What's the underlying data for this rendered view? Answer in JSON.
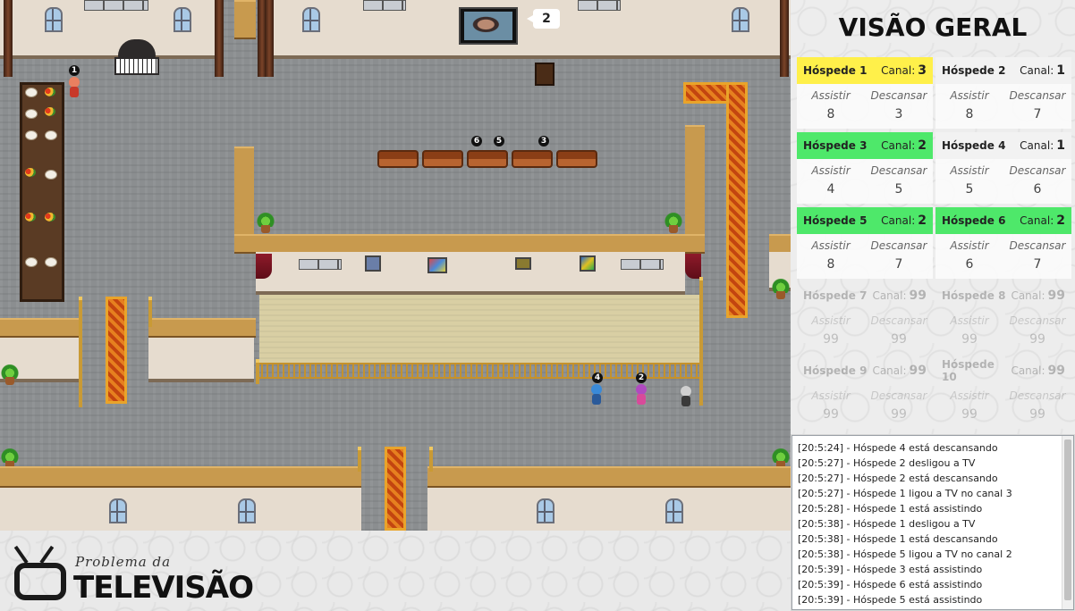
{
  "tv": {
    "channel_bubble": "2"
  },
  "map": {
    "table_guest": "1",
    "sofa_guests": [
      "6",
      "5",
      "3"
    ],
    "bottom_guests": [
      "4",
      "2"
    ]
  },
  "banner": {
    "subtitle": "Problema da",
    "title": "TELEVISÃO"
  },
  "panel": {
    "title": "VISÃO GERAL",
    "canal_label": "Canal:",
    "watch_label": "Assistir",
    "rest_label": "Descansar",
    "colors": {
      "watching": "#fff04a",
      "resting": "#4ee86a",
      "idle": "#f2f2f2"
    },
    "guests": [
      {
        "name": "Hóspede 1",
        "channel": "3",
        "watch": "8",
        "rest": "3",
        "state": "watching"
      },
      {
        "name": "Hóspede 2",
        "channel": "1",
        "watch": "8",
        "rest": "7",
        "state": "idle"
      },
      {
        "name": "Hóspede 3",
        "channel": "2",
        "watch": "4",
        "rest": "5",
        "state": "resting"
      },
      {
        "name": "Hóspede 4",
        "channel": "1",
        "watch": "5",
        "rest": "6",
        "state": "idle"
      },
      {
        "name": "Hóspede 5",
        "channel": "2",
        "watch": "8",
        "rest": "7",
        "state": "resting"
      },
      {
        "name": "Hóspede 6",
        "channel": "2",
        "watch": "6",
        "rest": "7",
        "state": "resting"
      },
      {
        "name": "Hóspede 7",
        "channel": "99",
        "watch": "99",
        "rest": "99",
        "state": "inactive"
      },
      {
        "name": "Hóspede 8",
        "channel": "99",
        "watch": "99",
        "rest": "99",
        "state": "inactive"
      },
      {
        "name": "Hóspede 9",
        "channel": "99",
        "watch": "99",
        "rest": "99",
        "state": "inactive"
      },
      {
        "name": "Hóspede 10",
        "channel": "99",
        "watch": "99",
        "rest": "99",
        "state": "inactive"
      }
    ]
  },
  "log": [
    "[20:5:24] - Hóspede 4 está descansando",
    "[20:5:27] - Hóspede 2 desligou a TV",
    "[20:5:27] - Hóspede 2 está descansando",
    "[20:5:27] - Hóspede 1 ligou a TV no canal 3",
    "[20:5:28] - Hóspede 1 está assistindo",
    "[20:5:38] - Hóspede 1 desligou a TV",
    "[20:5:38] - Hóspede 1 está descansando",
    "[20:5:38] - Hóspede 5 ligou a TV no canal 2",
    "[20:5:39] - Hóspede 3 está assistindo",
    "[20:5:39] - Hóspede 6 está assistindo",
    "[20:5:39] - Hóspede 5 está assistindo"
  ]
}
